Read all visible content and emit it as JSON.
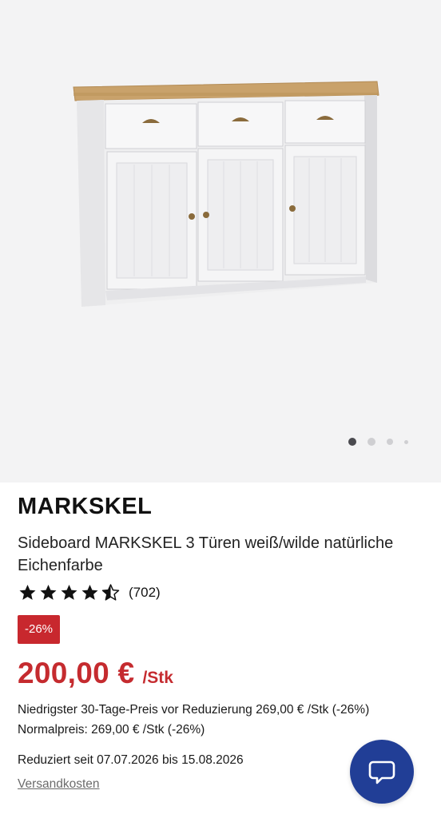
{
  "product": {
    "brand": "MARKSKEL",
    "title": "Sideboard MARKSKEL 3 Türen weiß/wilde natür­liche Eichenfarbe",
    "image_icon": "sideboard-image",
    "gallery": {
      "total_images": 4,
      "active_index": 0
    },
    "rating": {
      "value": 4.5,
      "max": 5,
      "count_label": "(702)"
    },
    "discount_badge": "-26%",
    "price": "200,00 €",
    "price_unit": "/Stk",
    "lowest_price_text": "Niedrigster 30-Tage-Preis vor Reduzierung 269,00 € /Stk (-26%)",
    "normal_price_text": "Normalpreis: 269,00 € /Stk (-26%)",
    "reduced_text": "Reduziert seit 07.07.2026 bis 15.08.2026",
    "shipping_link": "Versandkosten"
  },
  "chat": {
    "icon": "chat-bubble-icon"
  },
  "colors": {
    "accent_red": "#c52b2f",
    "badge_red": "#c8282e",
    "chat_blue": "#213e96",
    "gallery_bg": "#f3f3f4"
  }
}
